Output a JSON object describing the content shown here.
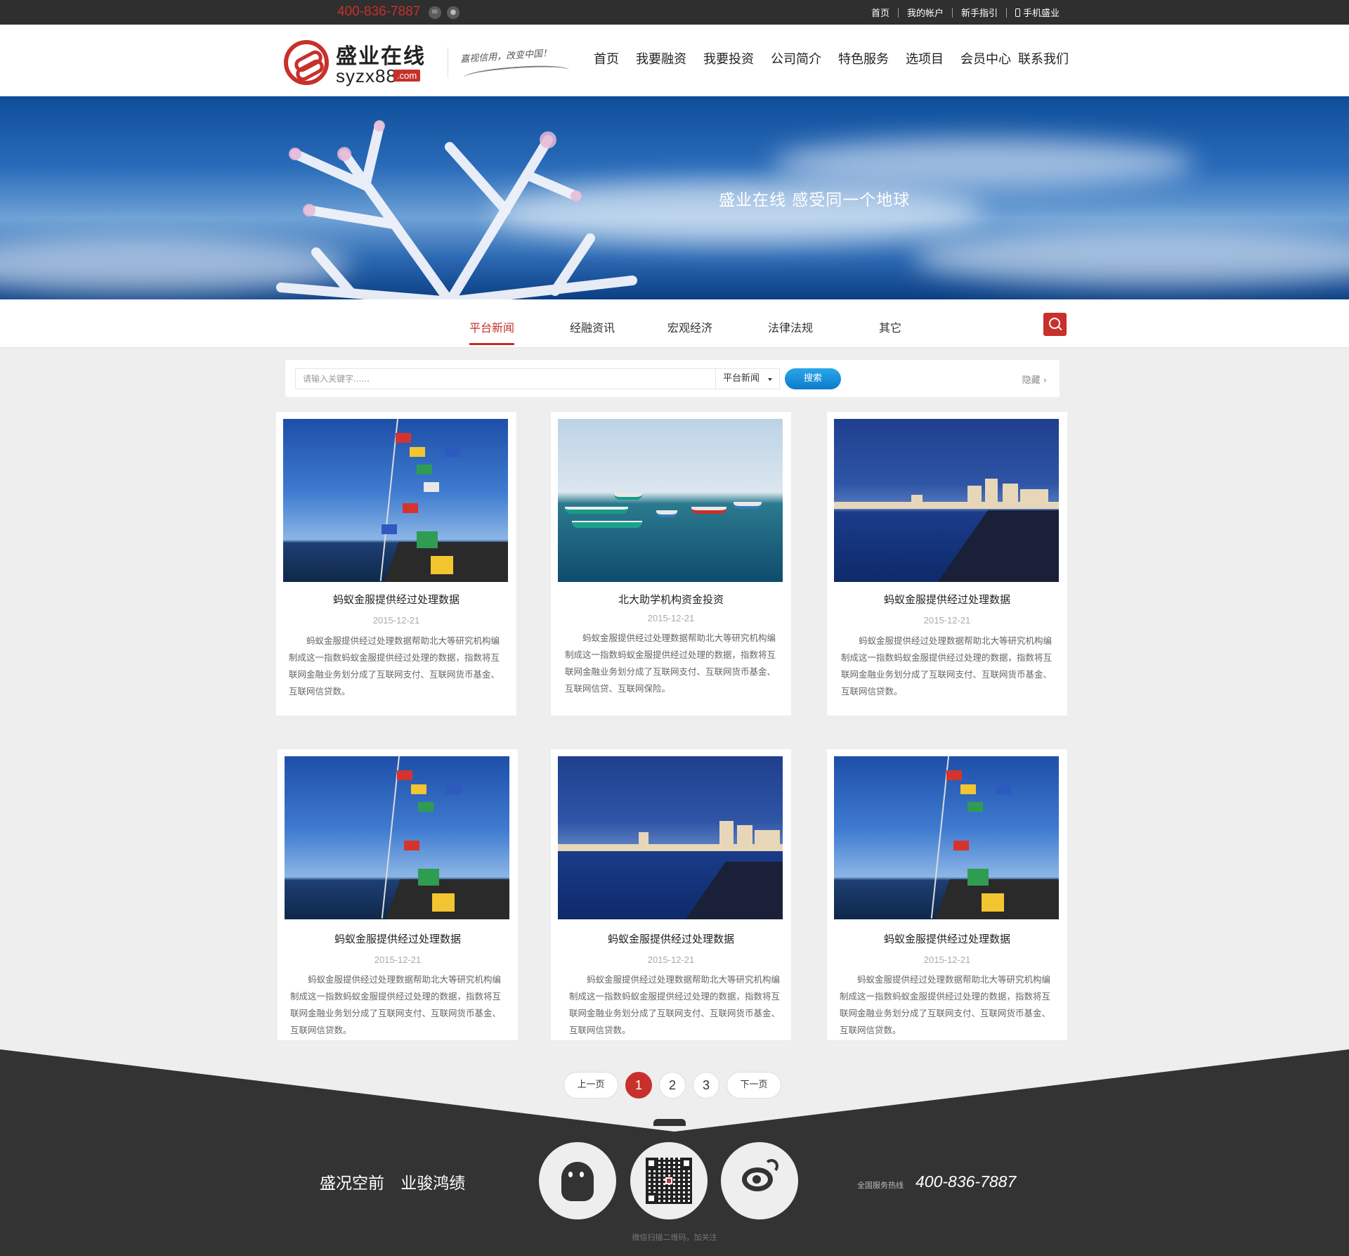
{
  "topbar": {
    "phone": "400-836-7887",
    "links": [
      "首页",
      "我的帐户",
      "新手指引",
      "手机盛业"
    ]
  },
  "header": {
    "logo_cn": "盛业在线",
    "logo_en": "syzx88",
    "logo_com": ".com",
    "slogan": "嘉视信用，改变中国！",
    "nav": [
      "首页",
      "我要融资",
      "我要投资",
      "公司简介",
      "特色服务",
      "选项目",
      "会员中心",
      "联系我们"
    ]
  },
  "banner": {
    "title": "盛业在线  感受同一个地球"
  },
  "categories": {
    "tabs": [
      "平台新闻",
      "经融资讯",
      "宏观经济",
      "法律法规",
      "其它"
    ],
    "active": "平台新闻"
  },
  "search": {
    "placeholder": "请输入关键字......",
    "category": "平台新闻",
    "button": "搜索",
    "hide": "隐藏"
  },
  "articles": [
    {
      "title": "蚂蚁金服提供经过处理数据",
      "date": "2015-12-21",
      "excerpt": "蚂蚁金服提供经过处理数据帮助北大等研究机构编制成这一指数蚂蚁金服提供经过处理的数据，指数将互联网金融业务划分成了互联网支付、互联网货币基金、互联网信贷数。",
      "image": "prayer-flags-sea"
    },
    {
      "title": "北大助学机构资金投资",
      "date": "2015-12-21",
      "excerpt": "蚂蚁金服提供经过处理数据帮助北大等研究机构编制成这一指数蚂蚁金服提供经过处理的数据，指数将互联网金融业务划分成了互联网支付、互联网货币基金、互联网信贷、互联网保险。",
      "image": "harbor-boats"
    },
    {
      "title": "蚂蚁金服提供经过处理数据",
      "date": "2015-12-21",
      "excerpt": "蚂蚁金服提供经过处理数据帮助北大等研究机构编制成这一指数蚂蚁金服提供经过处理的数据，指数将互联网金融业务划分成了互联网支付、互联网货币基金、互联网信贷数。",
      "image": "coastal-city"
    },
    {
      "title": "蚂蚁金服提供经过处理数据",
      "date": "2015-12-21",
      "excerpt": "蚂蚁金服提供经过处理数据帮助北大等研究机构编制成这一指数蚂蚁金服提供经过处理的数据，指数将互联网金融业务划分成了互联网支付、互联网货币基金、互联网信贷数。",
      "image": "prayer-flags-sea"
    },
    {
      "title": "蚂蚁金服提供经过处理数据",
      "date": "2015-12-21",
      "excerpt": "蚂蚁金服提供经过处理数据帮助北大等研究机构编制成这一指数蚂蚁金服提供经过处理的数据，指数将互联网金融业务划分成了互联网支付、互联网货币基金、互联网信贷数。",
      "image": "coastal-city"
    },
    {
      "title": "蚂蚁金服提供经过处理数据",
      "date": "2015-12-21",
      "excerpt": "蚂蚁金服提供经过处理数据帮助北大等研究机构编制成这一指数蚂蚁金服提供经过处理的数据，指数将互联网金融业务划分成了互联网支付、互联网货币基金、互联网信贷数。",
      "image": "prayer-flags-sea"
    }
  ],
  "pagination": {
    "prev": "上一页",
    "pages": [
      "1",
      "2",
      "3"
    ],
    "current": "1",
    "next": "下一页"
  },
  "footer": {
    "slogan": "盛况空前 业骏鸿绩",
    "hotline_label": "全国服务热线",
    "hotline": "400-836-7887",
    "wechat_tip": "微信扫描二维码，加关注",
    "icons": [
      "qq-icon",
      "wechat-qr-icon",
      "weibo-icon"
    ]
  },
  "colors": {
    "brand_red": "#c8302b",
    "topbar": "#2f2f2f",
    "footer": "#333333",
    "search_button": "#1a8fd8"
  }
}
